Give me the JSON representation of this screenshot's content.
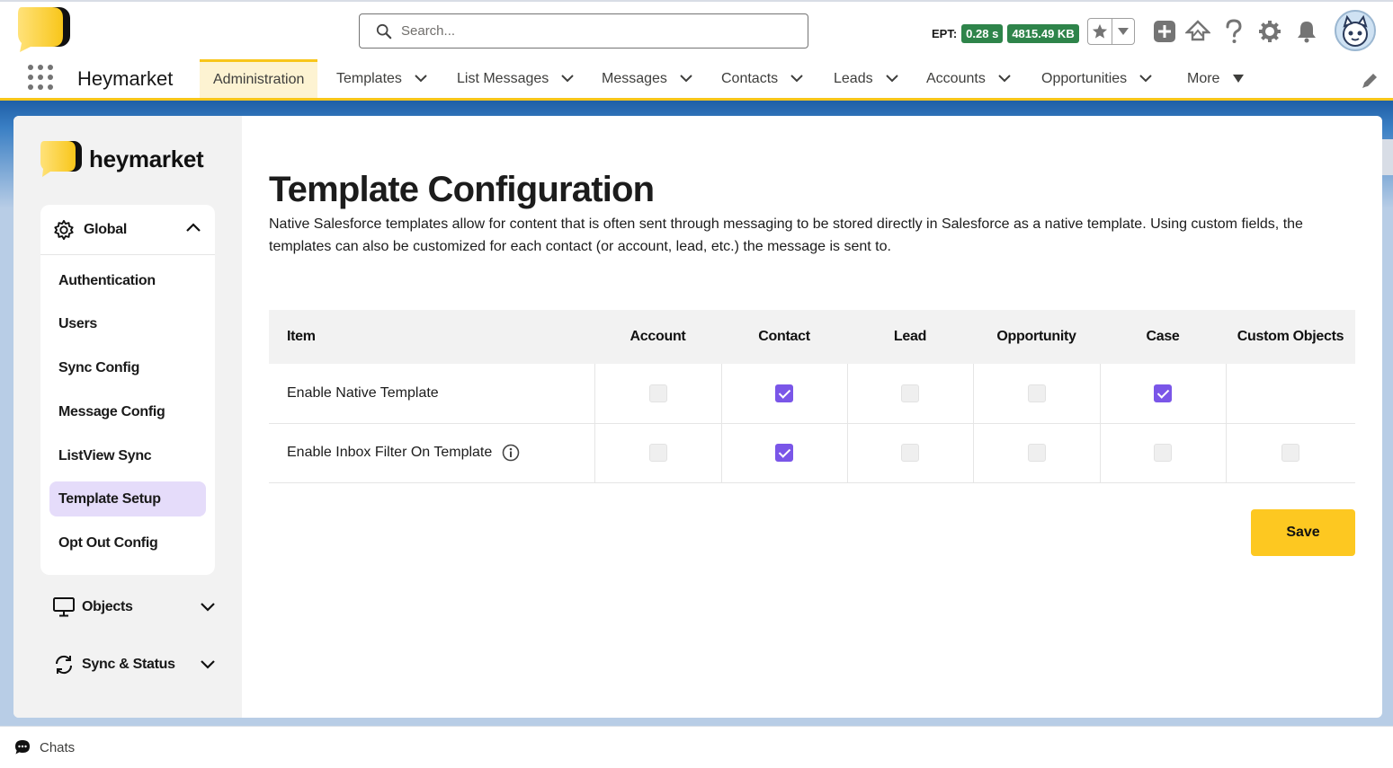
{
  "header": {
    "search_placeholder": "Search...",
    "ept_label": "EPT:",
    "ept_time": "0.28 s",
    "ept_size": "4815.49 KB"
  },
  "nav": {
    "app_name": "Heymarket",
    "items": [
      {
        "label": "Administration"
      },
      {
        "label": "Templates"
      },
      {
        "label": "List Messages"
      },
      {
        "label": "Messages"
      },
      {
        "label": "Contacts"
      },
      {
        "label": "Leads"
      },
      {
        "label": "Accounts"
      },
      {
        "label": "Opportunities"
      },
      {
        "label": "More"
      }
    ]
  },
  "sidebar": {
    "brand": "heymarket",
    "global_label": "Global",
    "items": [
      {
        "label": "Authentication"
      },
      {
        "label": "Users"
      },
      {
        "label": "Sync Config"
      },
      {
        "label": "Message Config"
      },
      {
        "label": "ListView Sync"
      },
      {
        "label": "Template Setup"
      },
      {
        "label": "Opt Out Config"
      }
    ],
    "objects_label": "Objects",
    "sync_label": "Sync & Status"
  },
  "main": {
    "title": "Template Configuration",
    "description": "Native Salesforce templates allow for content that is often sent through messaging to be stored directly in Salesforce as a native template. Using custom fields, the templates can also be customized for each contact (or account, lead, etc.) the message is sent to.",
    "columns": [
      "Item",
      "Account",
      "Contact",
      "Lead",
      "Opportunity",
      "Case",
      "Custom Objects"
    ],
    "rows": [
      {
        "label": "Enable Native Template",
        "checks": [
          false,
          true,
          false,
          false,
          true,
          null
        ]
      },
      {
        "label": "Enable Inbox Filter On Template",
        "checks": [
          false,
          true,
          false,
          false,
          false,
          false
        ]
      }
    ],
    "save_label": "Save"
  },
  "utility": {
    "chats_label": "Chats"
  },
  "colors": {
    "brand_yellow": "#fdc821",
    "accent_purple": "#7a56e8",
    "ept_green": "#2e844a"
  }
}
